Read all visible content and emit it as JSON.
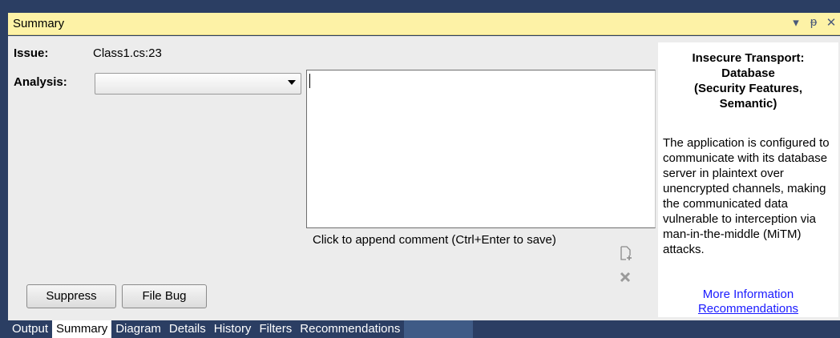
{
  "window": {
    "title": "Summary",
    "controls": [
      {
        "name": "dropdown-icon",
        "glyph": "▾"
      },
      {
        "name": "pin-icon",
        "glyph": "ᵽ"
      },
      {
        "name": "close-icon",
        "glyph": "✕"
      }
    ]
  },
  "issue": {
    "label": "Issue:",
    "value": "Class1.cs:23"
  },
  "analysis": {
    "label": "Analysis:",
    "selected": ""
  },
  "buttons": {
    "suppress": "Suppress",
    "file_bug": "File Bug"
  },
  "comment": {
    "text": "",
    "hint": "Click to append comment (Ctrl+Enter to save)"
  },
  "details": {
    "heading_line1": "Insecure Transport:",
    "heading_line2": "Database",
    "heading_line3": "(Security Features,",
    "heading_line4": "Semantic)",
    "description": "The application is configured to communicate with its database server in plaintext over unencrypted channels, making the communicated data vulnerable to interception via man-in-the-middle (MiTM) attacks.",
    "link_more": "More Information",
    "link_recommendations": "Recommendations"
  },
  "tabs": [
    {
      "label": "Output",
      "active": false
    },
    {
      "label": "Summary",
      "active": true
    },
    {
      "label": "Diagram",
      "active": false
    },
    {
      "label": "Details",
      "active": false
    },
    {
      "label": "History",
      "active": false
    },
    {
      "label": "Filters",
      "active": false
    },
    {
      "label": "Recommendations",
      "active": false
    }
  ]
}
